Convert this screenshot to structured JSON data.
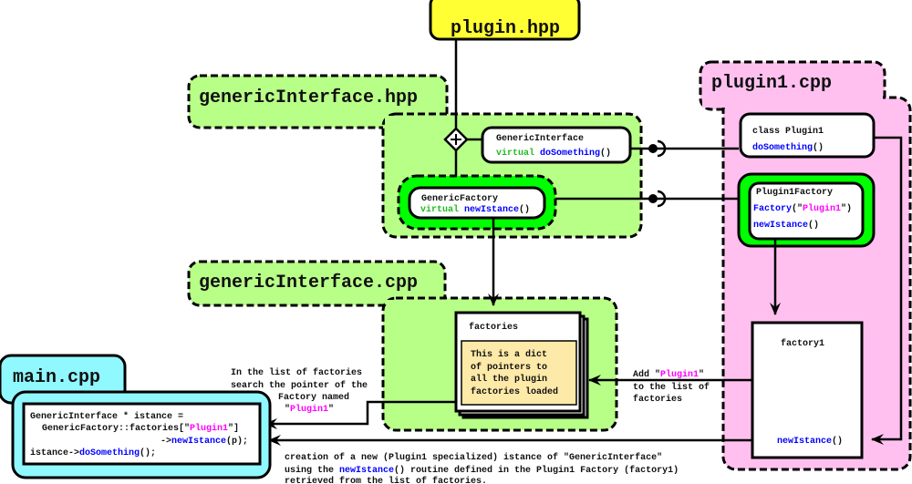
{
  "colors": {
    "header_file": "#ffff33",
    "generic_green": "#b8ff88",
    "factory_green": "#00ff00",
    "plugin_pink": "#ffc0f0",
    "main_cyan": "#90f8ff",
    "note_yellow": "#fde9a8",
    "method_blue": "#0000ff",
    "string_magenta": "#ff00ff",
    "keyword_green": "#22bb22"
  },
  "files": {
    "plugin_hpp": "plugin.hpp",
    "generic_interface_hpp": "genericInterface.hpp",
    "generic_interface_cpp": "genericInterface.cpp",
    "plugin1_cpp": "plugin1.cpp",
    "main_cpp": "main.cpp"
  },
  "generic_interface": {
    "name": "GenericInterface",
    "keyword": "virtual",
    "method": "doSomething",
    "parens": "()"
  },
  "generic_factory": {
    "name": "GenericFactory",
    "keyword": "virtual",
    "method": "newIstance",
    "parens": "()"
  },
  "plugin1_class": {
    "name": "class Plugin1",
    "method": "doSomething",
    "parens": "()"
  },
  "plugin1_factory": {
    "name": "Plugin1Factory",
    "ctor": "Factory",
    "open": "(\"",
    "arg": "Plugin1",
    "close": "\")",
    "method": "newIstance",
    "parens": "()"
  },
  "factory1": {
    "name": "factory1",
    "method": "newIstance",
    "parens": "()"
  },
  "factories": {
    "title": "factories",
    "note": [
      "This is a dict",
      "of pointers to",
      "all the plugin",
      "factories loaded"
    ]
  },
  "main_code": {
    "l1": "GenericInterface * istance =",
    "l2a": "GenericFactory::factories[\"",
    "l2b": "Plugin1",
    "l2c": "\"]",
    "l3a": "->",
    "l3b": "newIstance",
    "l3c": "(p);",
    "l4a": "istance->",
    "l4b": "doSomething",
    "l4c": "();"
  },
  "annotations": {
    "search": [
      "In the list of factories",
      "search the pointer of the",
      "Factory named"
    ],
    "search_q1": "\"",
    "search_name": "Plugin1",
    "search_q2": "\"",
    "add_a": "Add \"",
    "add_name": "Plugin1",
    "add_b": "\"",
    "add_rest": [
      "to the list of",
      "factories"
    ],
    "creation_1": "creation of a new (Plugin1 specialized) istance of \"GenericInterface\"",
    "creation_2a": "using the ",
    "creation_2b": "newIstance",
    "creation_2c": "() routine defined in the Plugin1 Factory (factory1)",
    "creation_3": "retrieved from the list of factories."
  }
}
